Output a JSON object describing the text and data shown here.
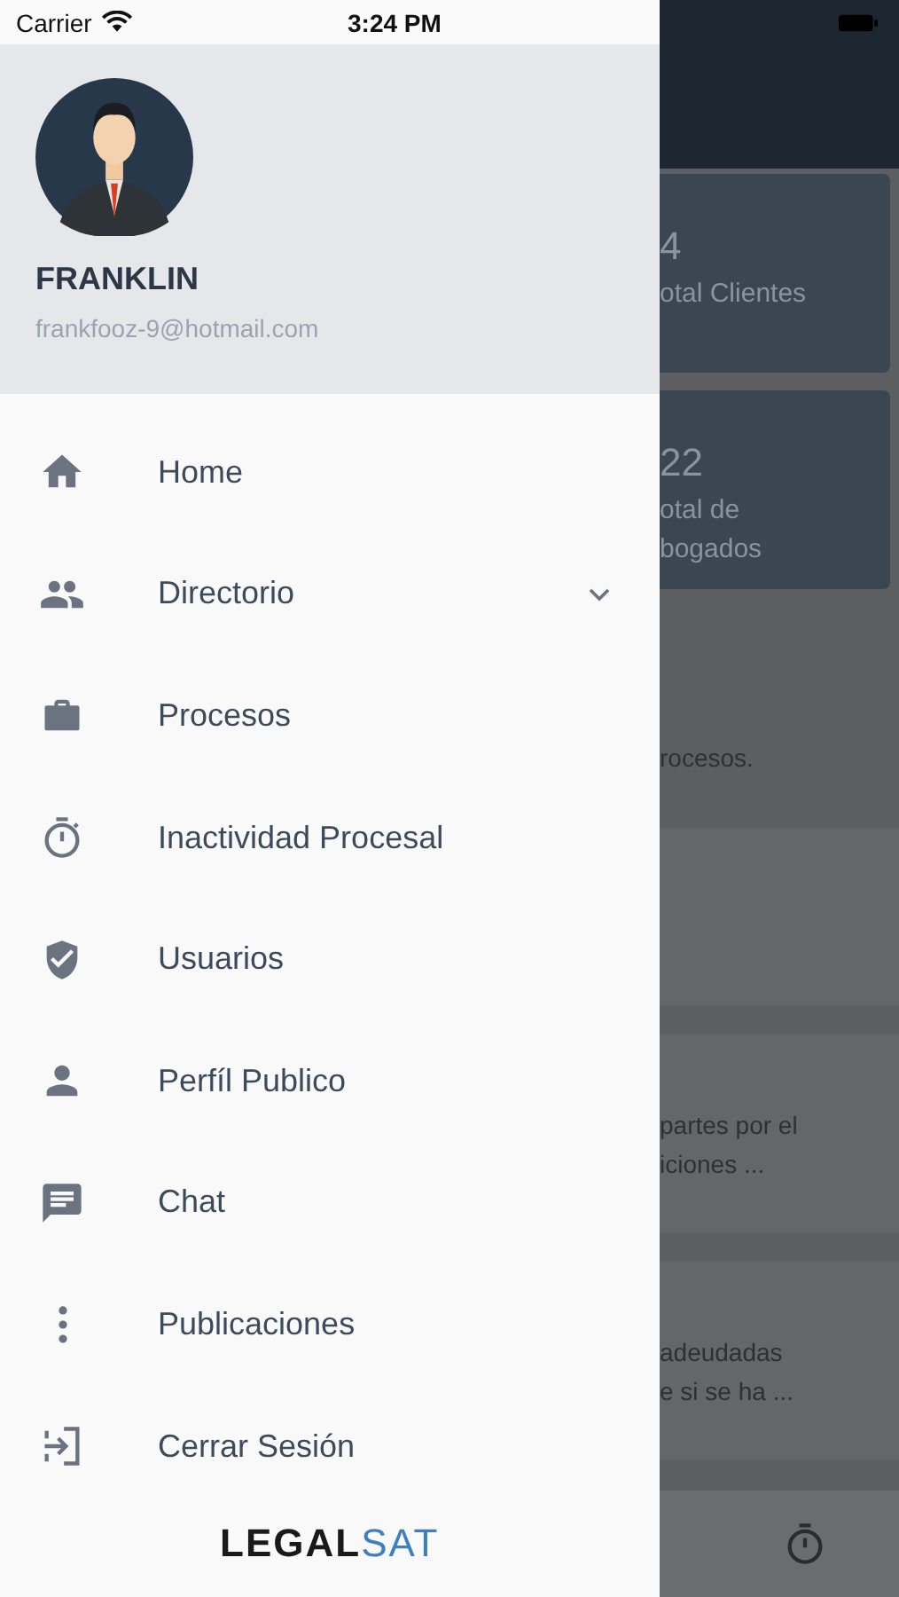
{
  "status_bar": {
    "carrier": "Carrier",
    "time": "3:24 PM"
  },
  "drawer": {
    "user": {
      "name": "FRANKLIN",
      "email": "frankfooz-9@hotmail.com"
    },
    "menu": [
      {
        "label": "Home",
        "kind": "link"
      },
      {
        "label": "Directorio",
        "kind": "group",
        "expanded": false
      },
      {
        "label": "Procesos",
        "kind": "link"
      },
      {
        "label": "Inactividad Procesal",
        "kind": "link"
      },
      {
        "label": "Usuarios",
        "kind": "link"
      },
      {
        "label": "Perfíl Publico",
        "kind": "link"
      },
      {
        "label": "Chat",
        "kind": "link"
      },
      {
        "label": "Publicaciones",
        "kind": "link"
      },
      {
        "label": "Cerrar Sesión",
        "kind": "link"
      }
    ],
    "logo": {
      "dark": "LEGAL",
      "accent": "SAT"
    }
  },
  "background": {
    "cards": [
      {
        "value": "4",
        "lines": [
          "otal Clientes"
        ]
      },
      {
        "value": "22",
        "lines": [
          "otal de",
          "bogados"
        ]
      }
    ],
    "texts": [
      "rocesos."
    ],
    "items": [
      {
        "lines": [
          "partes por el",
          "iciones ..."
        ]
      },
      {
        "lines": [
          "adeudadas",
          "e si se ha ..."
        ]
      }
    ]
  }
}
